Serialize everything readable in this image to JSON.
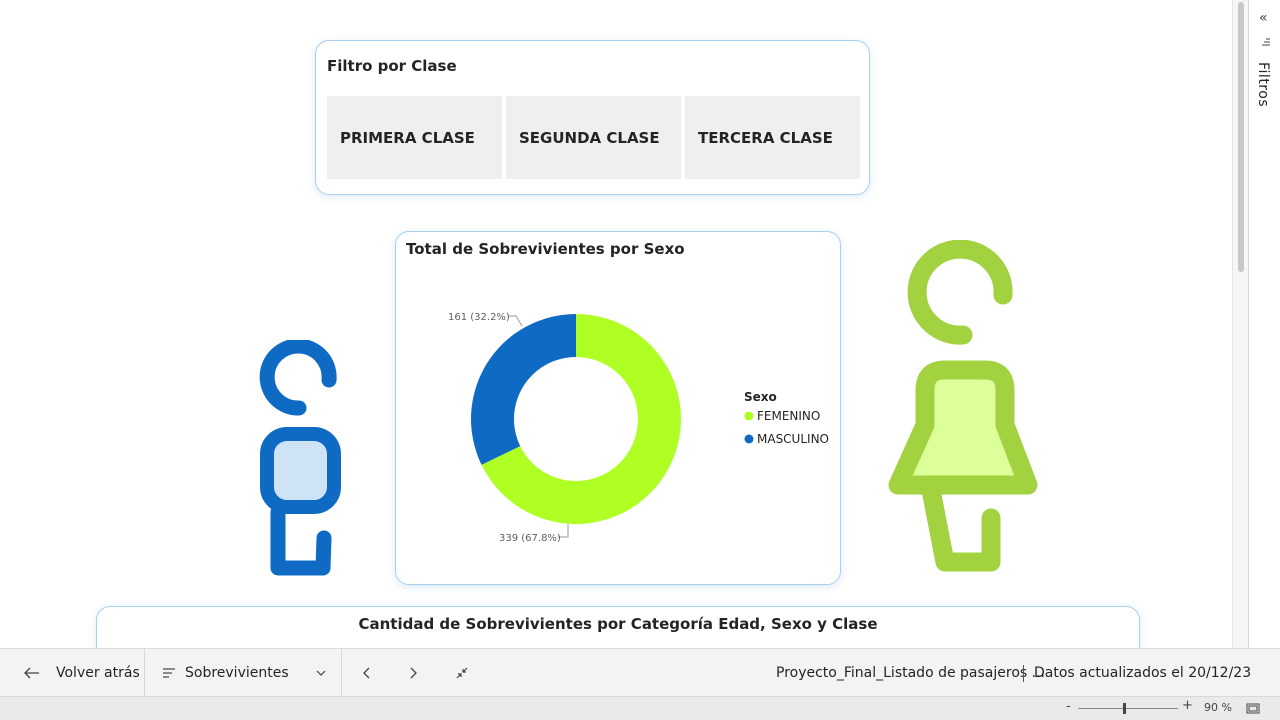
{
  "filter": {
    "title": "Filtro por Clase",
    "options": [
      "PRIMERA CLASE",
      "SEGUNDA CLASE",
      "TERCERA CLASE"
    ]
  },
  "chart_data": {
    "type": "pie",
    "title": "Total de Sobrevivientes por Sexo",
    "legend_title": "Sexo",
    "legend_position": "right",
    "slices": [
      {
        "name": "FEMENINO",
        "value": 339,
        "label": "339 (67.8%)",
        "color": "#b0ff24"
      },
      {
        "name": "MASCULINO",
        "value": 161,
        "label": "161 (32.2%)",
        "color": "#0f6ac4"
      }
    ]
  },
  "bottom_chart": {
    "title": "Cantidad de Sobrevivientes por Categoría Edad, Sexo y Clase"
  },
  "figures": {
    "male_color": "#0f6ac4",
    "male_fill": "#cfe3f7",
    "female_color": "#a2d240",
    "female_fill": "#ddff99"
  },
  "filter_pane": {
    "label": "Filtros",
    "collapse_icon": "double-chevron-left-icon"
  },
  "navbar": {
    "back_label": "Volver atrás",
    "page_select": "Sobrevivientes",
    "file_name": "Proyecto_Final_Listado de pasajeros ...",
    "updated": "Datos actualizados el 20/12/23"
  },
  "statusbar": {
    "zoom": "90 %",
    "zoom_level": 0.9
  }
}
